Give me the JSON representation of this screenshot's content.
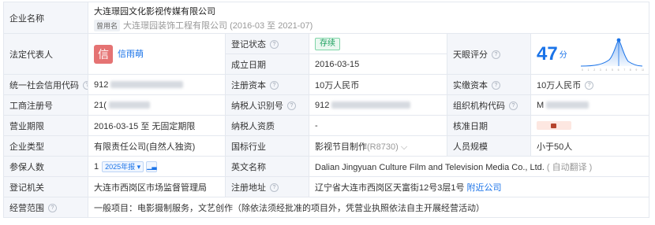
{
  "labels": {
    "company_name": "企业名称",
    "legal_rep": "法定代表人",
    "reg_status": "登记状态",
    "est_date": "成立日期",
    "tianyan_score": "天眼评分",
    "credit_code": "统一社会信用代码",
    "reg_capital": "注册资本",
    "paid_capital": "实缴资本",
    "reg_no": "工商注册号",
    "taxpayer_id": "纳税人识别号",
    "org_code": "组织机构代码",
    "business_term": "营业期限",
    "taxpayer_qual": "纳税人资质",
    "approval_date": "核准日期",
    "company_type": "企业类型",
    "industry": "国标行业",
    "staff_size": "人员规模",
    "insured": "参保人数",
    "english_name": "英文名称",
    "reg_authority": "登记机关",
    "reg_address": "注册地址",
    "business_scope": "经营范围"
  },
  "values": {
    "company_name": "大连璟园文化影视传媒有限公司",
    "used_name_tag": "曾用名",
    "used_name": "大连璟园装饰工程有限公司 (2016-03 至 2021-07)",
    "legal_rep_avatar": "信",
    "legal_rep_name": "信雨萌",
    "reg_status": "存续",
    "est_date": "2016-03-15",
    "score_value": "47",
    "score_unit": "分",
    "credit_code_prefix": "912",
    "reg_capital": "10万人民币",
    "paid_capital": "10万人民币",
    "reg_no_prefix": "21(",
    "taxpayer_id_prefix": "912",
    "org_code_prefix": "M",
    "business_term": "2016-03-15 至 无固定期限",
    "taxpayer_qual": "-",
    "company_type": "有限责任公司(自然人独资)",
    "industry": "影视节目制作",
    "industry_code": "(R8730)",
    "staff_size": "小于50人",
    "insured_count": "1",
    "insured_year": "2025年报",
    "english_name": "Dalian Jingyuan Culture Film and Television Media Co., Ltd.",
    "english_note": "( 自动翻译 )",
    "reg_authority": "大连市西岗区市场监督管理局",
    "reg_address": "辽宁省大连市西岗区天富街12号3层1号",
    "nearby_link": "附近公司",
    "business_scope": "一般项目：电影摄制服务，文艺创作（除依法须经批准的项目外，凭营业执照依法自主开展经营活动）"
  },
  "icons": {
    "help": "question-icon",
    "chevron": "chevron-down-icon",
    "chart": "chart-icon",
    "lock": "lock-icon"
  },
  "colors": {
    "link": "#1a73e8",
    "label_bg": "#f4f6fa",
    "status_green": "#1a9e5c",
    "avatar_red": "#e57373"
  },
  "score_chart": {
    "x_ticks": [
      "0",
      "1",
      "2",
      "3",
      "4",
      "5",
      "6",
      "7",
      "8",
      "9",
      "10"
    ]
  }
}
